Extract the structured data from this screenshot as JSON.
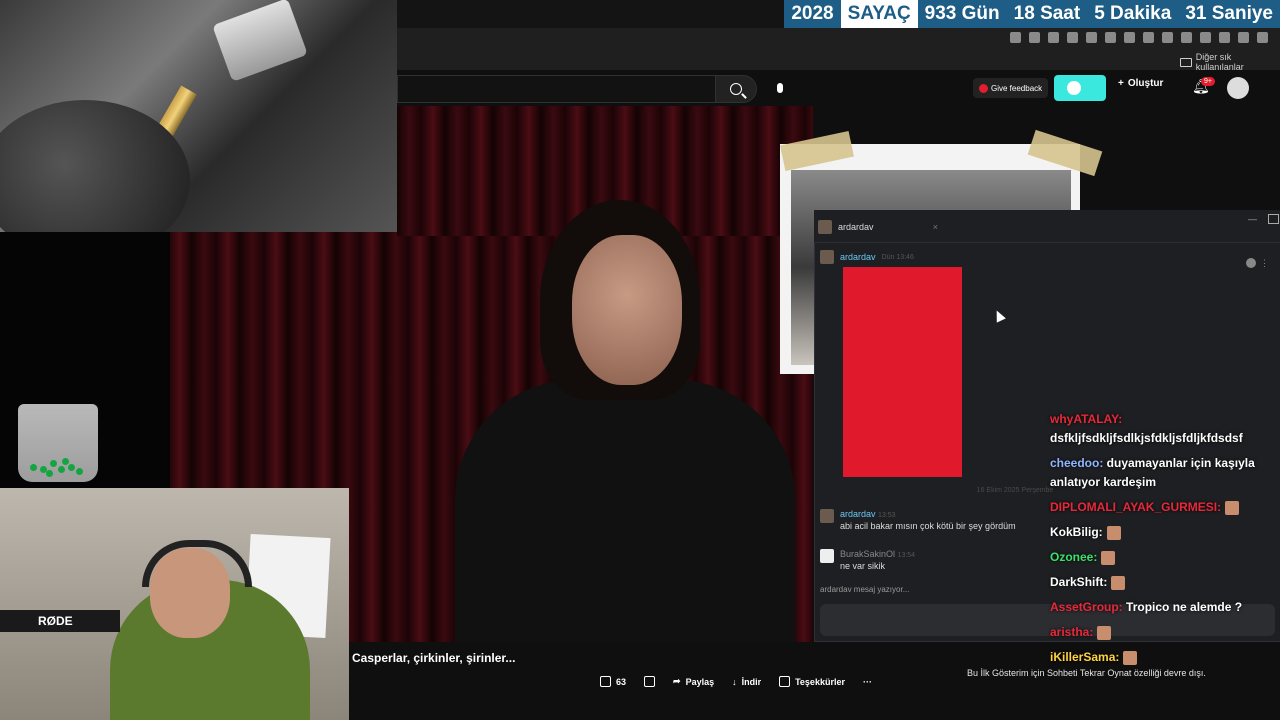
{
  "countdown": {
    "year": "2028",
    "label": "SAYAÇ",
    "days": "933 Gün",
    "hours": "18 Saat",
    "minutes": "5 Dakika",
    "seconds": "31 Saniye"
  },
  "browser": {
    "bookmarks_folder": "Diğer sık kullanılanlar"
  },
  "youtube": {
    "give_feedback": "Give feedback",
    "create": "Oluştur",
    "notif_count": "9+",
    "video_title": "Casperlar, çirkinler, şirinler...",
    "actions": {
      "likes": "63",
      "share": "Paylaş",
      "download": "İndir",
      "thanks": "Teşekkürler",
      "more": "···"
    },
    "premiere_note": "Bu İlk Gösterim için Sohbeti Tekrar Oynat özelliği devre dışı."
  },
  "webcam": {
    "mic_brand": "RØDE"
  },
  "chat_window": {
    "tab_name": "ardardav",
    "msg1": {
      "author": "ardardav",
      "time": "Dün 13:46"
    },
    "date_divider": "16 Ekim 2025 Perşembe",
    "msg2": {
      "author": "ardardav",
      "time": "13:53",
      "text": "abi acil bakar mısın çok kötü bir şey gördüm"
    },
    "msg3": {
      "author": "BurakSakinOl",
      "time": "13:54",
      "text": "ne var sikik"
    },
    "typing": "ardardav mesaj yazıyor..."
  },
  "overlay_chat": [
    {
      "user": "whyATALAY:",
      "user_color": "#e8283a",
      "text": "dsfkljfsdkljfsdlkjsfdkljsfdljkfdsdsf"
    },
    {
      "user": "cheedoo:",
      "user_color": "#8fb6ff",
      "text": "duyamayanlar için kaşıyla anlatıyor kardeşim"
    },
    {
      "user": "DIPLOMALI_AYAK_GURMESI:",
      "user_color": "#e8283a",
      "text": ""
    },
    {
      "user": "KokBilig:",
      "user_color": "#ffffff",
      "text": ""
    },
    {
      "user": "Ozonee:",
      "user_color": "#39e06b",
      "text": ""
    },
    {
      "user": "DarkShift:",
      "user_color": "#ffffff",
      "text": ""
    },
    {
      "user": "AssetGroup:",
      "user_color": "#e8283a",
      "text": "Tropico ne alemde ?"
    },
    {
      "user": "aristha:",
      "user_color": "#e8283a",
      "text": ""
    },
    {
      "user": "iKillerSama:",
      "user_color": "#ffd33d",
      "text": ""
    }
  ]
}
